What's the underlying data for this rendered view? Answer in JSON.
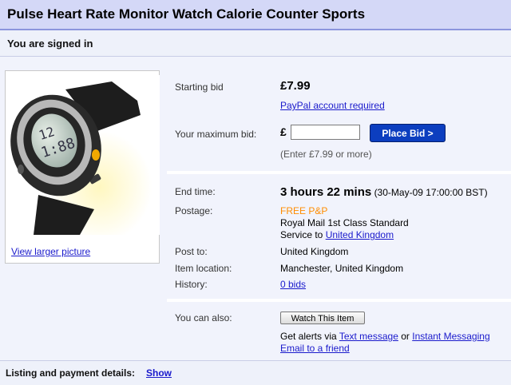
{
  "title": "Pulse Heart Rate Monitor Watch Calorie Counter Sports",
  "signed_in": "You are signed in",
  "image": {
    "view_larger": "View larger picture",
    "icon": "watch-photo"
  },
  "bid": {
    "starting_label": "Starting bid",
    "starting_value": "£7.99",
    "paypal": "PayPal account required",
    "max_label": "Your maximum bid:",
    "currency": "£",
    "max_value": "",
    "place_bid": "Place Bid >",
    "hint": "(Enter £7.99 or more)"
  },
  "details": {
    "end_label": "End time:",
    "end_left": "3 hours 22 mins",
    "end_date": "(30-May-09 17:00:00 BST)",
    "postage_label": "Postage:",
    "postage_free": "FREE P&P",
    "postage_service": "Royal Mail 1st Class Standard",
    "service_to": "Service to",
    "service_country": "United Kingdom",
    "post_to_label": "Post to:",
    "post_to_value": "United Kingdom",
    "location_label": "Item location:",
    "location_value": "Manchester, United Kingdom",
    "history_label": "History:",
    "history_value": "0 bids"
  },
  "also": {
    "label": "You can also:",
    "watch": "Watch This Item",
    "alerts_prefix": "Get alerts via",
    "text_message": "Text message",
    "or": "or",
    "instant": "Instant Messaging",
    "email": "Email to a friend"
  },
  "listing": {
    "label": "Listing and payment details:",
    "show": "Show"
  },
  "colors": {
    "title_bar": "#d4d8f7",
    "accent_line": "#8c95dd",
    "button": "#0c3ebf",
    "free_pp": "#ff8c00",
    "link": "#1a1acc"
  }
}
